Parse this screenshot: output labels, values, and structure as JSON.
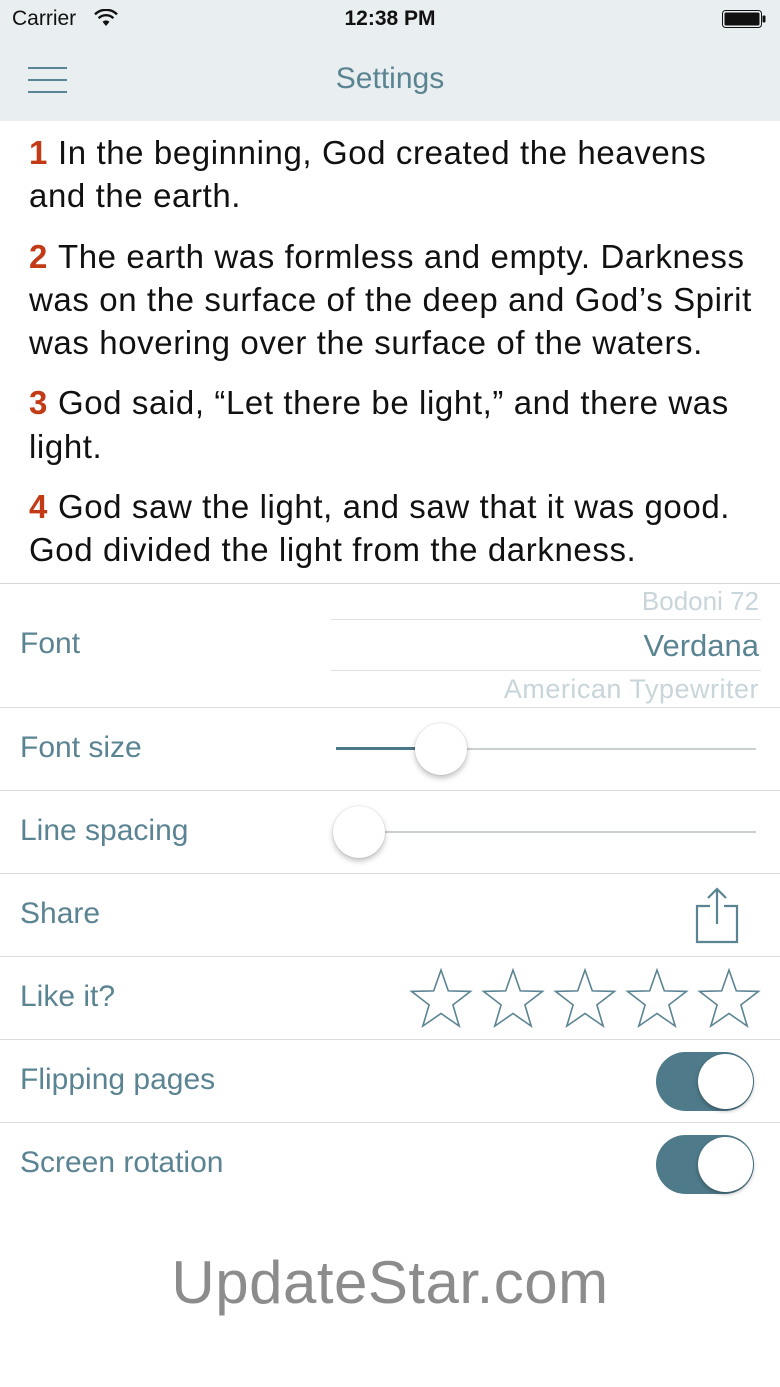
{
  "status_bar": {
    "carrier": "Carrier",
    "time": "12:38 PM"
  },
  "nav": {
    "title": "Settings",
    "menu_icon": "hamburger-menu-icon"
  },
  "verses": [
    {
      "num": "1",
      "text": "In the beginning, God created the heavens and the earth."
    },
    {
      "num": "2",
      "text": "The earth was formless and empty. Darkness was on the surface of the deep and God’s Spirit was hovering over the surface of the waters."
    },
    {
      "num": "3",
      "text": "God said, “Let there be light,” and there was light."
    },
    {
      "num": "4",
      "text": "God saw the light, and saw that it was good. God divided the light from the darkness."
    }
  ],
  "settings": {
    "font": {
      "label": "Font",
      "options": [
        "Bodoni 72",
        "Verdana",
        "American Typewriter"
      ],
      "selected": "Verdana"
    },
    "font_size": {
      "label": "Font size",
      "value": 0.25
    },
    "line_spacing": {
      "label": "Line spacing",
      "value": 0.0
    },
    "share": {
      "label": "Share",
      "icon": "share-icon"
    },
    "rating": {
      "label": "Like it?",
      "stars_total": 5,
      "stars_filled": 0
    },
    "flipping_pages": {
      "label": "Flipping pages",
      "enabled": true
    },
    "screen_rotation": {
      "label": "Screen rotation",
      "enabled": true
    }
  },
  "watermark": "UpdateStar.com",
  "colors": {
    "accent": "#5b8493",
    "toggle_on": "#4e7a8a",
    "verse_number": "#c23b16",
    "bar_background": "#e9eef0"
  }
}
